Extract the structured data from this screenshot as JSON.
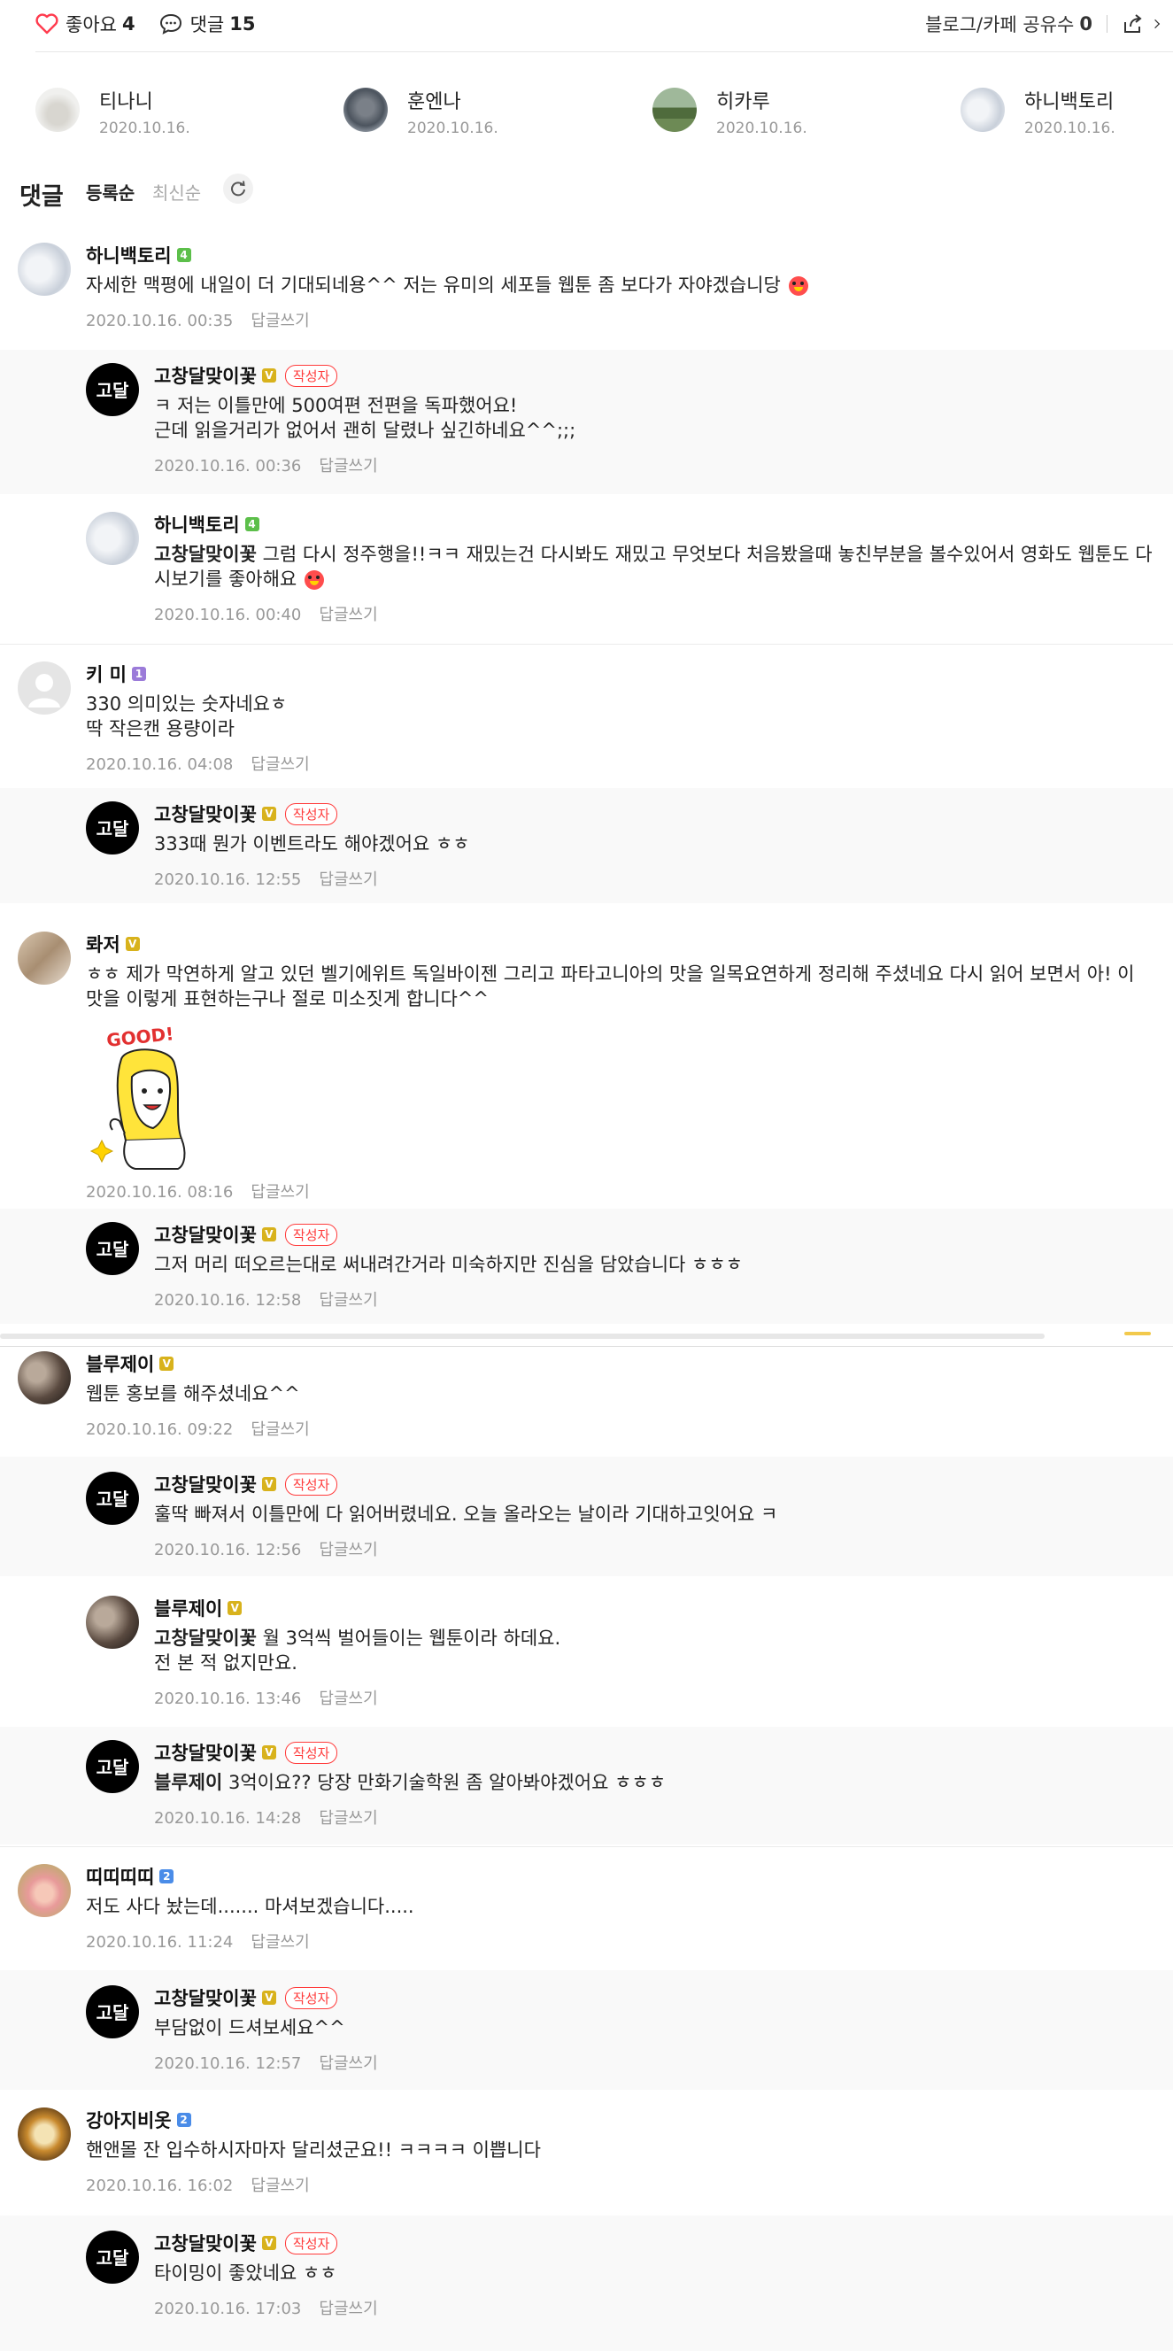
{
  "topbar": {
    "like_label": "좋아요",
    "like_count": "4",
    "comment_label": "댓글",
    "comment_count": "15",
    "share_label": "블로그/카페 공유수",
    "share_count": "0"
  },
  "likers": [
    {
      "name": "티나니",
      "date": "2020.10.16."
    },
    {
      "name": "훈엔나",
      "date": "2020.10.16."
    },
    {
      "name": "히카루",
      "date": "2020.10.16."
    },
    {
      "name": "하니백토리",
      "date": "2020.10.16."
    }
  ],
  "comment_section": {
    "title": "댓글",
    "sort_registered": "등록순",
    "sort_latest": "최신순"
  },
  "reply_label": "답글쓰기",
  "author_badge": "작성자",
  "comments": [
    {
      "name": "하니백토리",
      "text": "자세한 맥평에 내일이 더 기대되네용^^ 저는 유미의 세포들 웹툰 좀 보다가 자야겠습니당",
      "date": "2020.10.16. 00:35"
    },
    {
      "name": "고창달맞이꽃",
      "text": "ㅋ 저는 이틀만에 500여편 전편을 독파했어요!\n근데 읽을거리가 없어서 괜히 달렸나 싶긴하네요^^;;;",
      "date": "2020.10.16. 00:36"
    },
    {
      "name": "하니백토리",
      "mention": "고창달맞이꽃",
      "text": " 그럼 다시 정주행을!!ㅋㅋ 재밌는건 다시봐도 재밌고 무엇보다 처음봤을때 놓친부분을 볼수있어서 영화도 웹툰도 다시보기를 좋아해요",
      "date": "2020.10.16. 00:40"
    },
    {
      "name": "키 미",
      "text": "330 의미있는 숫자네요ㅎ\n딱 작은캔 용량이라",
      "date": "2020.10.16. 04:08"
    },
    {
      "name": "고창달맞이꽃",
      "text": "333때 뭔가 이벤트라도 해야겠어요 ㅎㅎ",
      "date": "2020.10.16. 12:55"
    },
    {
      "name": "롸저",
      "text": "ㅎㅎ 제가 막연하게 알고 있던 벨기에위트 독일바이젠 그리고 파타고니아의 맛을 일목요연하게 정리해 주셨네요 다시 읽어 보면서 아! 이 맛을 이렇게 표현하는구나 절로 미소짓게 합니다^^",
      "sticker": "GOOD!",
      "date": "2020.10.16. 08:16"
    },
    {
      "name": "고창달맞이꽃",
      "text": "그저 머리 떠오르는대로 써내려간거라 미숙하지만 진심을 담았습니다 ㅎㅎㅎ",
      "date": "2020.10.16. 12:58"
    },
    {
      "name": "블루제이",
      "text": "웹툰 홍보를 해주셨네요^^",
      "date": "2020.10.16. 09:22"
    },
    {
      "name": "고창달맞이꽃",
      "text": "훌딱 빠져서 이틀만에 다 읽어버렸네요. 오늘 올라오는 날이라 기대하고잇어요 ㅋ",
      "date": "2020.10.16. 12:56"
    },
    {
      "name": "블루제이",
      "mention": "고창달맞이꽃",
      "text": " 월 3억씩 벌어들이는 웹툰이라 하데요.\n전 본 적 없지만요.",
      "date": "2020.10.16. 13:46"
    },
    {
      "name": "고창달맞이꽃",
      "mention": "블루제이",
      "text": " 3억이요?? 당장 만화기술학원 좀 알아봐야겠어요 ㅎㅎㅎ",
      "date": "2020.10.16. 14:28"
    },
    {
      "name": "띠띠띠띠",
      "text": "저도 사다 놨는데....... 마셔보겠습니다.....",
      "date": "2020.10.16. 11:24"
    },
    {
      "name": "고창달맞이꽃",
      "text": "부담없이 드셔보세요^^",
      "date": "2020.10.16. 12:57"
    },
    {
      "name": "강아지비옷",
      "text": "핸앤몰 잔 입수하시자마자 달리셨군요!! ㅋㅋㅋㅋ 이쁩니다",
      "date": "2020.10.16. 16:02"
    },
    {
      "name": "고창달맞이꽃",
      "text": "타이밍이 좋았네요 ㅎㅎ",
      "date": "2020.10.16. 17:03"
    }
  ],
  "colors": {
    "heart": "#ff3b4e",
    "author_badge": "#ff3b3b",
    "reply_bg": "#f9f9f9",
    "level_green": "#5cbf4a",
    "level_yellow": "#d8b21c",
    "level_purple": "#9b7bd9",
    "level_blue": "#4a8ce8"
  }
}
